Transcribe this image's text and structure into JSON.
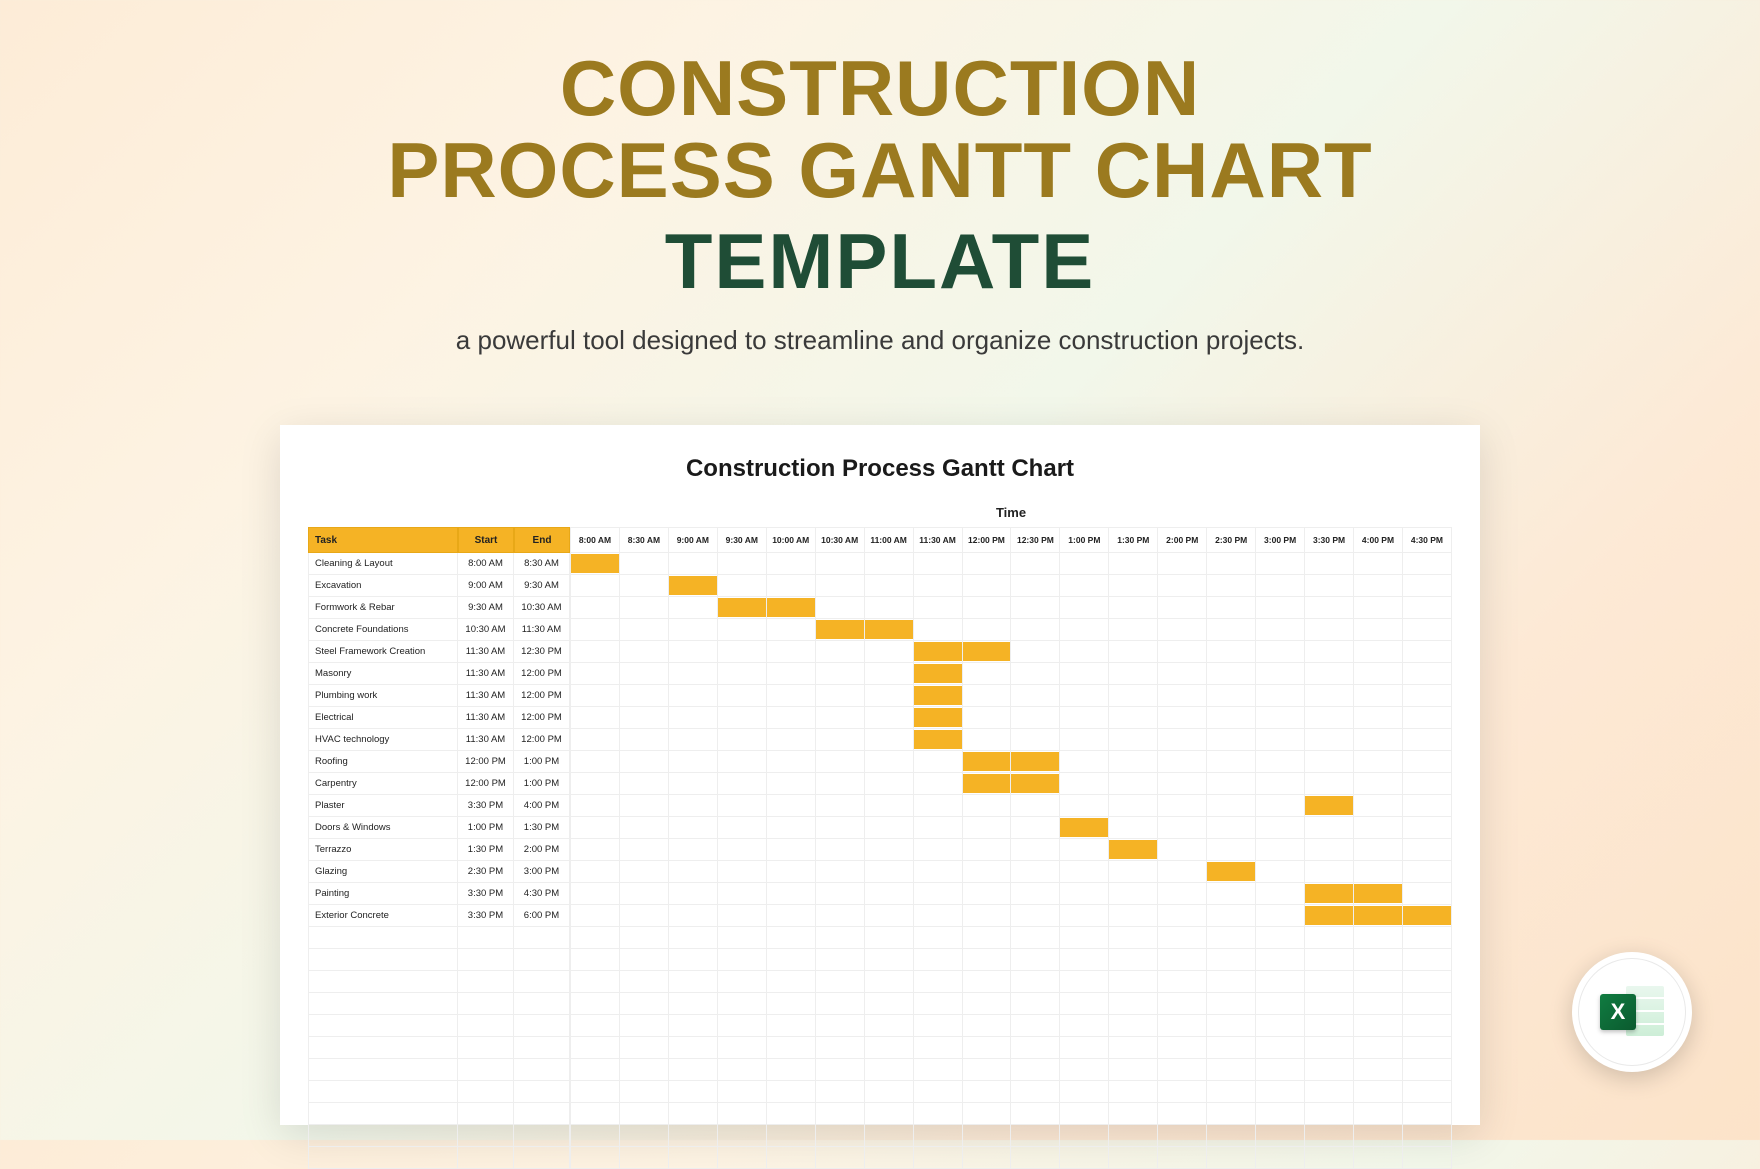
{
  "hero": {
    "title_line1": "CONSTRUCTION",
    "title_line2": "PROCESS GANTT CHART",
    "template_word": "TEMPLATE",
    "subtitle": "a powerful tool designed to streamline and organize construction projects."
  },
  "sheet": {
    "title": "Construction Process Gantt Chart",
    "time_heading": "Time",
    "columns": {
      "task": "Task",
      "start": "Start",
      "end": "End"
    }
  },
  "badge": {
    "excel_letter": "X"
  },
  "chart_data": {
    "type": "bar",
    "orientation": "horizontal-gantt",
    "time_axis": [
      "8:00 AM",
      "8:30 AM",
      "9:00 AM",
      "9:30 AM",
      "10:00 AM",
      "10:30 AM",
      "11:00 AM",
      "11:30 AM",
      "12:00 PM",
      "12:30 PM",
      "1:00 PM",
      "1:30 PM",
      "2:00 PM",
      "2:30 PM",
      "3:00 PM",
      "3:30 PM",
      "4:00 PM",
      "4:30 PM"
    ],
    "tasks": [
      {
        "name": "Cleaning & Layout",
        "start": "8:00 AM",
        "end": "8:30 AM"
      },
      {
        "name": "Excavation",
        "start": "9:00 AM",
        "end": "9:30 AM"
      },
      {
        "name": "Formwork & Rebar",
        "start": "9:30 AM",
        "end": "10:30 AM"
      },
      {
        "name": "Concrete Foundations",
        "start": "10:30 AM",
        "end": "11:30 AM"
      },
      {
        "name": "Steel Framework Creation",
        "start": "11:30 AM",
        "end": "12:30 PM"
      },
      {
        "name": "Masonry",
        "start": "11:30 AM",
        "end": "12:00 PM"
      },
      {
        "name": "Plumbing work",
        "start": "11:30 AM",
        "end": "12:00 PM"
      },
      {
        "name": "Electrical",
        "start": "11:30 AM",
        "end": "12:00 PM"
      },
      {
        "name": "HVAC technology",
        "start": "11:30 AM",
        "end": "12:00 PM"
      },
      {
        "name": "Roofing",
        "start": "12:00 PM",
        "end": "1:00 PM"
      },
      {
        "name": "Carpentry",
        "start": "12:00 PM",
        "end": "1:00 PM"
      },
      {
        "name": "Plaster",
        "start": "3:30 PM",
        "end": "4:00 PM"
      },
      {
        "name": "Doors & Windows",
        "start": "1:00 PM",
        "end": "1:30 PM"
      },
      {
        "name": "Terrazzo",
        "start": "1:30 PM",
        "end": "2:00 PM"
      },
      {
        "name": "Glazing",
        "start": "2:30 PM",
        "end": "3:00 PM"
      },
      {
        "name": "Painting",
        "start": "3:30 PM",
        "end": "4:30 PM"
      },
      {
        "name": "Exterior Concrete",
        "start": "3:30 PM",
        "end": "6:00 PM"
      }
    ],
    "empty_rows": 11,
    "bar_color": "#f5b325",
    "title": "Construction Process Gantt Chart",
    "xlabel": "Time",
    "ylabel": "Task"
  }
}
